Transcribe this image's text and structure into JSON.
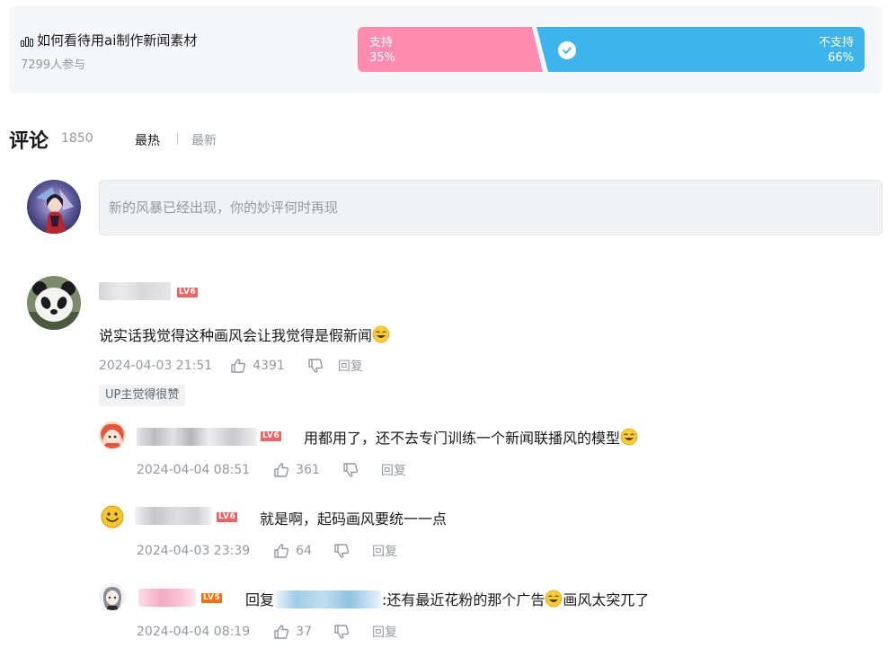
{
  "vote": {
    "title": "如何看待用ai制作新闻素材",
    "participants": "7299人参与",
    "support_label": "支持",
    "support_percent": "35%",
    "oppose_label": "不支持",
    "oppose_percent": "66%"
  },
  "comments_header": {
    "title": "评论",
    "count": "1850",
    "sort_hot": "最热",
    "sort_new": "最新"
  },
  "reply_box": {
    "placeholder": "新的风暴已经出现，你的妙评何时再现"
  },
  "main_comment": {
    "level": "LV6",
    "text": "说实话我觉得这种画风会让我觉得是假新闻",
    "time": "2024-04-03 21:51",
    "likes": "4391",
    "reply_label": "回复",
    "up_tag": "UP主觉得很赞"
  },
  "replies": [
    {
      "level": "LV6",
      "text": "用都用了，还不去专门训练一个新闻联播风的模型",
      "time": "2024-04-04 08:51",
      "likes": "361",
      "reply_label": "回复"
    },
    {
      "level": "LV6",
      "text": "就是啊，起码画风要统一一点",
      "time": "2024-04-03 23:39",
      "likes": "64",
      "reply_label": "回复"
    },
    {
      "level": "LV5",
      "reply_prefix": "回复",
      "text": ":还有最近花粉的那个广告",
      "text_suffix": "画风太突兀了",
      "time": "2024-04-04 08:19",
      "likes": "37",
      "reply_label": "回复"
    }
  ],
  "colors": {
    "support": "#ff8cb0",
    "oppose": "#3db5ea",
    "level6": "#f36262",
    "level5": "#ff6c00",
    "meta_text": "#9499a0"
  },
  "icons": [
    "bar-chart-icon",
    "check-icon",
    "like-icon",
    "dislike-icon",
    "laugh-cry-emoji"
  ]
}
